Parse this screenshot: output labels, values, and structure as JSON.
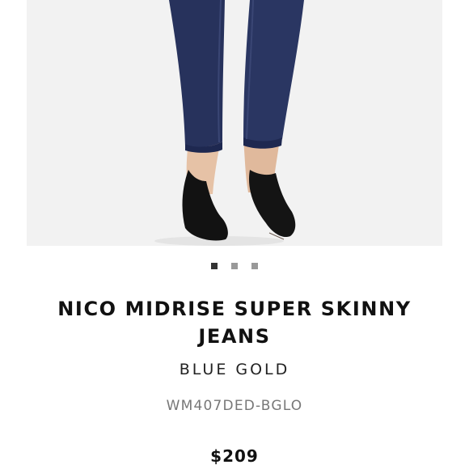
{
  "product": {
    "image_alt": "Product photo: dark blue skinny jeans with black suede pumps",
    "gallery": {
      "count": 3,
      "active_index": 0
    },
    "name": "NICO MIDRISE SUPER SKINNY JEANS",
    "color": "BLUE GOLD",
    "sku": "WM407DED-BGLO",
    "price": "$209"
  },
  "colors": {
    "denim": "#26325a",
    "shoe": "#121212",
    "skin": "#e6c2a6",
    "background": "#f2f2f2",
    "dot_active": "#333333",
    "dot_inactive": "#999999"
  }
}
